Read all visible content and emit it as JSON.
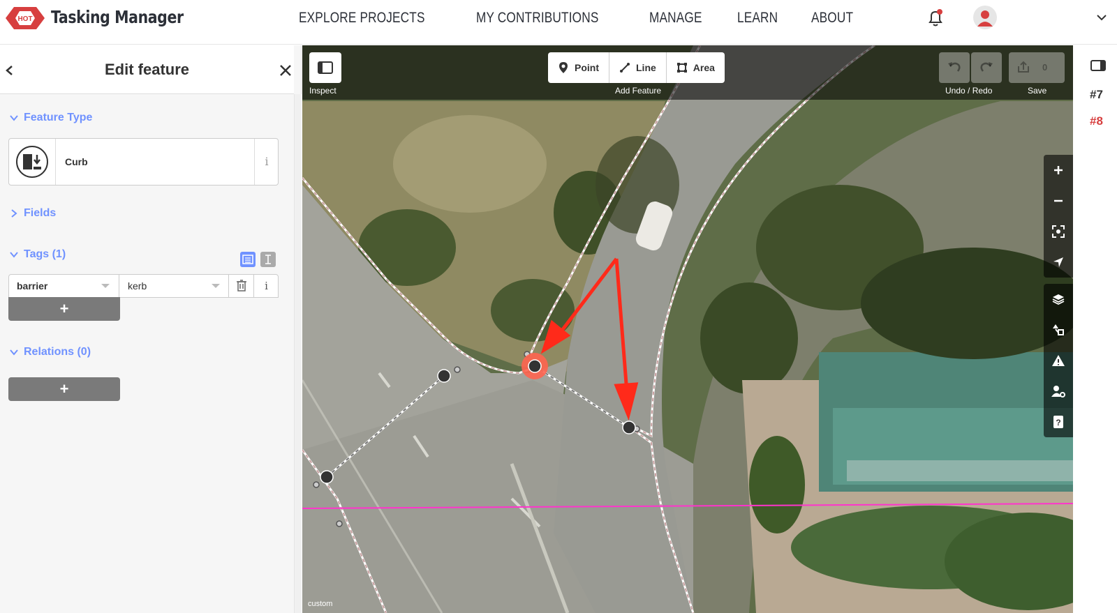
{
  "app": {
    "title": "Tasking Manager",
    "nav": [
      "EXPLORE PROJECTS",
      "MY CONTRIBUTIONS",
      "MANAGE",
      "LEARN",
      "ABOUT"
    ],
    "logo_text": "HOT"
  },
  "sidebar": {
    "title": "Edit feature",
    "feature_type": {
      "heading": "Feature Type",
      "preset": "Curb",
      "info": "i"
    },
    "fields_heading": "Fields",
    "tags": {
      "heading": "Tags (1)",
      "key": "barrier",
      "value": "kerb",
      "info": "i",
      "add": "+"
    },
    "relations": {
      "heading": "Relations (0)",
      "add": "+"
    }
  },
  "map": {
    "inspect_label": "Inspect",
    "add_feature_label": "Add Feature",
    "buttons": {
      "point": "Point",
      "line": "Line",
      "area": "Area"
    },
    "undo_redo_label": "Undo / Redo",
    "save_label": "Save",
    "save_count": "0",
    "attribution": "custom"
  },
  "right_strip": {
    "task_a": "#7",
    "task_b": "#8"
  },
  "colors": {
    "brand_red": "#d73f3f",
    "section_blue": "#7092ff",
    "annotation_red": "#ff2a1a"
  }
}
